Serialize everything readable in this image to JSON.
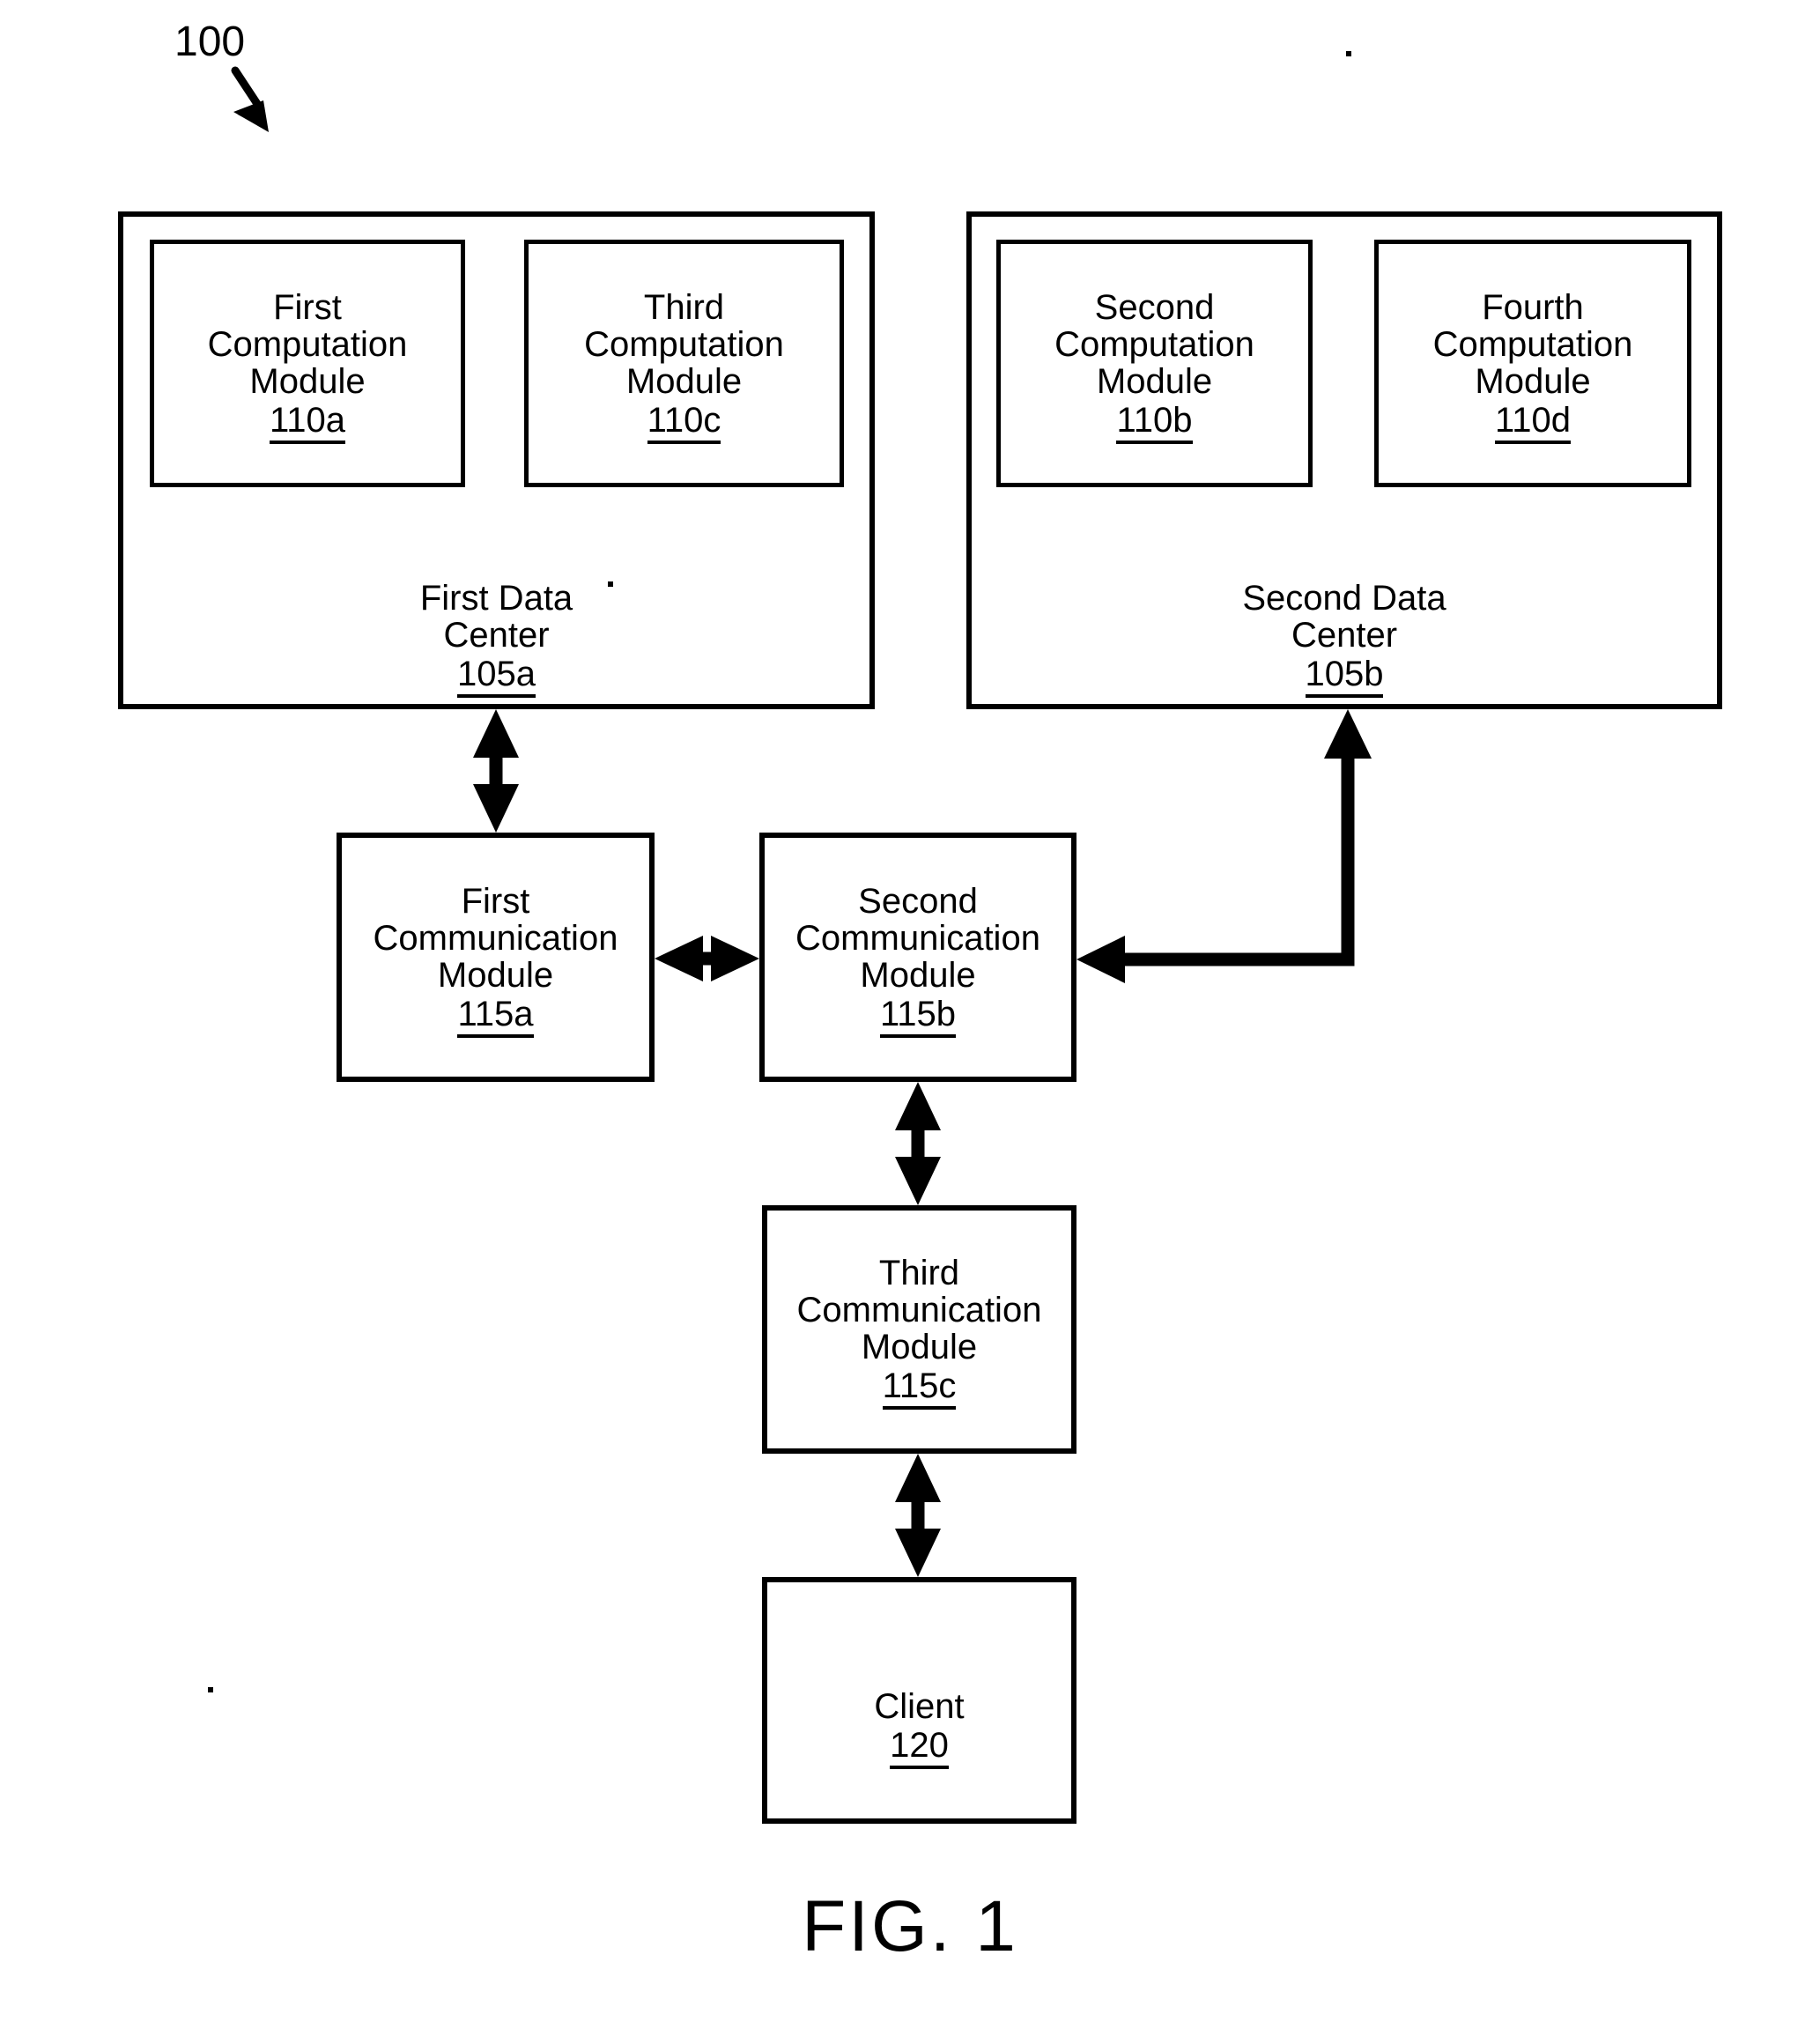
{
  "figure": {
    "callout": "100",
    "caption": "FIG. 1"
  },
  "colors": {
    "stroke": "#000000",
    "background": "#ffffff"
  },
  "data_centers": [
    {
      "id": "first-data-center",
      "name": "First Data\nCenter",
      "ref": "105a",
      "modules": [
        {
          "id": "first-computation-module",
          "name": "First\nComputation\nModule",
          "ref": "110a"
        },
        {
          "id": "third-computation-module",
          "name": "Third\nComputation\nModule",
          "ref": "110c"
        }
      ]
    },
    {
      "id": "second-data-center",
      "name": "Second Data\nCenter",
      "ref": "105b",
      "modules": [
        {
          "id": "second-computation-module",
          "name": "Second\nComputation\nModule",
          "ref": "110b"
        },
        {
          "id": "fourth-computation-module",
          "name": "Fourth\nComputation\nModule",
          "ref": "110d"
        }
      ]
    }
  ],
  "communication_modules": [
    {
      "id": "first-communication-module",
      "name": "First\nCommunication\nModule",
      "ref": "115a"
    },
    {
      "id": "second-communication-module",
      "name": "Second\nCommunication\nModule",
      "ref": "115b"
    },
    {
      "id": "third-communication-module",
      "name": "Third\nCommunication\nModule",
      "ref": "115c"
    }
  ],
  "client": {
    "id": "client",
    "name": "Client",
    "ref": "120"
  },
  "connections": [
    {
      "id": "conn-dc1-comm1",
      "from": "first-data-center",
      "to": "first-communication-module",
      "style": "double-arrow-vertical"
    },
    {
      "id": "conn-comm1-comm2",
      "from": "first-communication-module",
      "to": "second-communication-module",
      "style": "double-arrow-horizontal"
    },
    {
      "id": "conn-dc2-comm2",
      "from": "second-data-center",
      "to": "second-communication-module",
      "style": "elbow-double-arrow"
    },
    {
      "id": "conn-comm2-comm3",
      "from": "second-communication-module",
      "to": "third-communication-module",
      "style": "double-arrow-vertical"
    },
    {
      "id": "conn-comm3-client",
      "from": "third-communication-module",
      "to": "client",
      "style": "double-arrow-vertical"
    }
  ]
}
